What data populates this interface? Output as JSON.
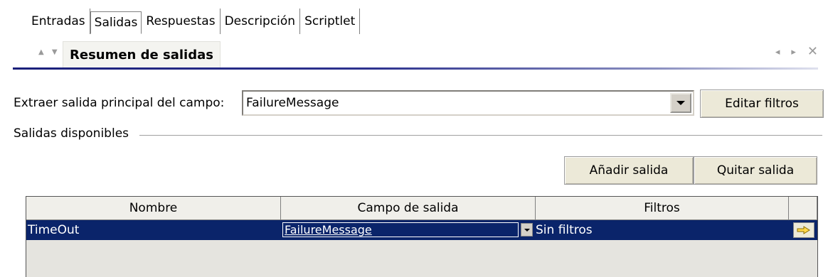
{
  "tabs": [
    {
      "label": "Entradas"
    },
    {
      "label": "Salidas"
    },
    {
      "label": "Respuestas"
    },
    {
      "label": "Descripción"
    },
    {
      "label": "Scriptlet"
    }
  ],
  "active_tab": "Salidas",
  "section": {
    "title": "Resumen de salidas",
    "collapse_arrows": "▲ ▼",
    "nav_prev": "◂",
    "nav_next": "▸",
    "close": "✕"
  },
  "main_field": {
    "label": "Extraer salida principal del campo:",
    "value": "FailureMessage",
    "edit_filters_label": "Editar filtros"
  },
  "outputs": {
    "group_label": "Salidas disponibles",
    "add_label": "Añadir salida",
    "remove_label": "Quitar salida",
    "columns": [
      "Nombre",
      "Campo de salida",
      "Filtros"
    ],
    "rows": [
      {
        "name": "TimeOut",
        "field": "FailureMessage",
        "filters": "Sin filtros"
      }
    ]
  },
  "colors": {
    "selection": "#0a246a",
    "accent_rule": "#1a1f7a"
  },
  "icons": {
    "dropdown": "chevron-down-icon",
    "edit_filters_row": "edit-arrow-icon"
  }
}
